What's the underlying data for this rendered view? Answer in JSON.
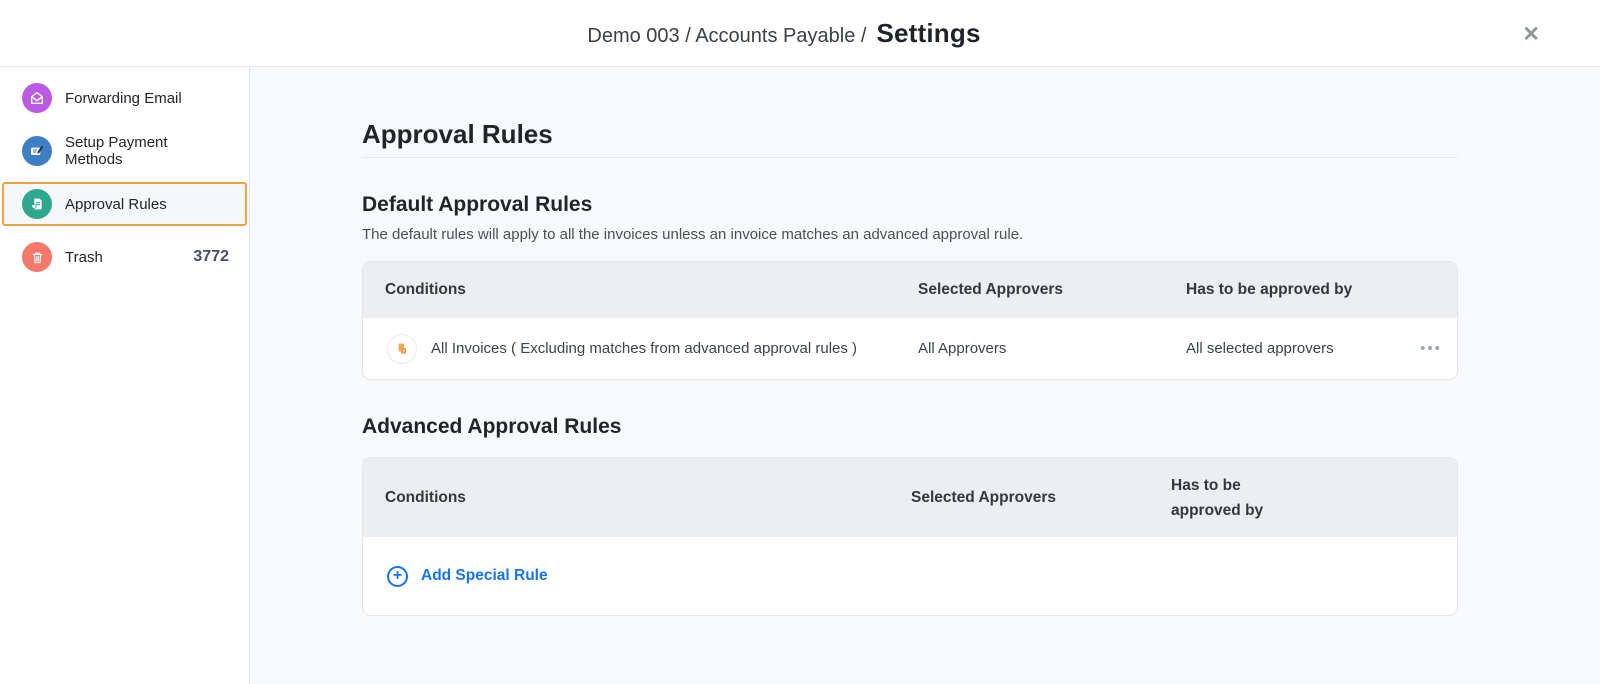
{
  "header": {
    "breadcrumb": "Demo 003 / Accounts Payable /",
    "title": "Settings",
    "close_glyph": "✕"
  },
  "sidebar": {
    "items": [
      {
        "label": "Forwarding Email",
        "icon": "envelope-icon",
        "color": "#bb5be4",
        "selected": false
      },
      {
        "label": "Setup Payment Methods",
        "icon": "payment-note-icon",
        "color": "#3d7fc4",
        "selected": false
      },
      {
        "label": "Approval Rules",
        "icon": "approval-document-icon",
        "color": "#2fa78f",
        "selected": true
      },
      {
        "label": "Trash",
        "icon": "trash-icon",
        "color": "#f4796b",
        "selected": false,
        "badge": "3772"
      }
    ],
    "selected_border_color": "#efa23d"
  },
  "main": {
    "page_title": "Approval Rules",
    "default_section": {
      "heading": "Default Approval Rules",
      "description": "The default rules will apply to all the invoices unless an invoice matches an advanced approval rule.",
      "table": {
        "headers": [
          "Conditions",
          "Selected Approvers",
          "Has to be approved by"
        ],
        "rows": [
          {
            "condition": "All Invoices ( Excluding matches from advanced approval rules )",
            "selected_approvers": "All Approvers",
            "approved_by": "All selected approvers",
            "menu_glyph": "•••"
          }
        ]
      }
    },
    "advanced_section": {
      "heading": "Advanced Approval Rules",
      "table": {
        "headers": [
          "Conditions",
          "Selected Approvers",
          "Has to be approved by"
        ]
      },
      "add_rule": {
        "label": "Add Special Rule",
        "plus_glyph": "+",
        "color": "#1674f0"
      }
    }
  }
}
